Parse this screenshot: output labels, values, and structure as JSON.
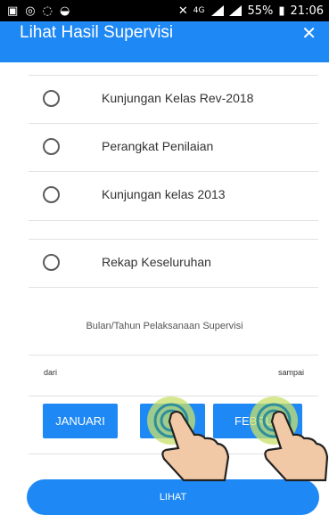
{
  "status_bar": {
    "network": "4G",
    "battery": "55%",
    "time": "21:06"
  },
  "header": {
    "title": "Lihat Hasil Supervisi",
    "close": "✕"
  },
  "options": [
    {
      "label": "Kunjungan Kelas Rev-2018"
    },
    {
      "label": "Perangkat Penilaian"
    },
    {
      "label": "Kunjungan kelas 2013"
    },
    {
      "label": "Rekap Keseluruhan"
    }
  ],
  "period": {
    "title": "Bulan/Tahun Pelaksanaan Supervisi",
    "from_label": "dari",
    "to_label": "sampai",
    "from_month": "JANUARI",
    "to_month": "FEBRU"
  },
  "submit_label": "LIHAT",
  "colors": {
    "primary": "#1e88f5",
    "tap_ring": "#c8e06a"
  },
  "icons": [
    "close-icon",
    "tap-gesture-icon"
  ]
}
